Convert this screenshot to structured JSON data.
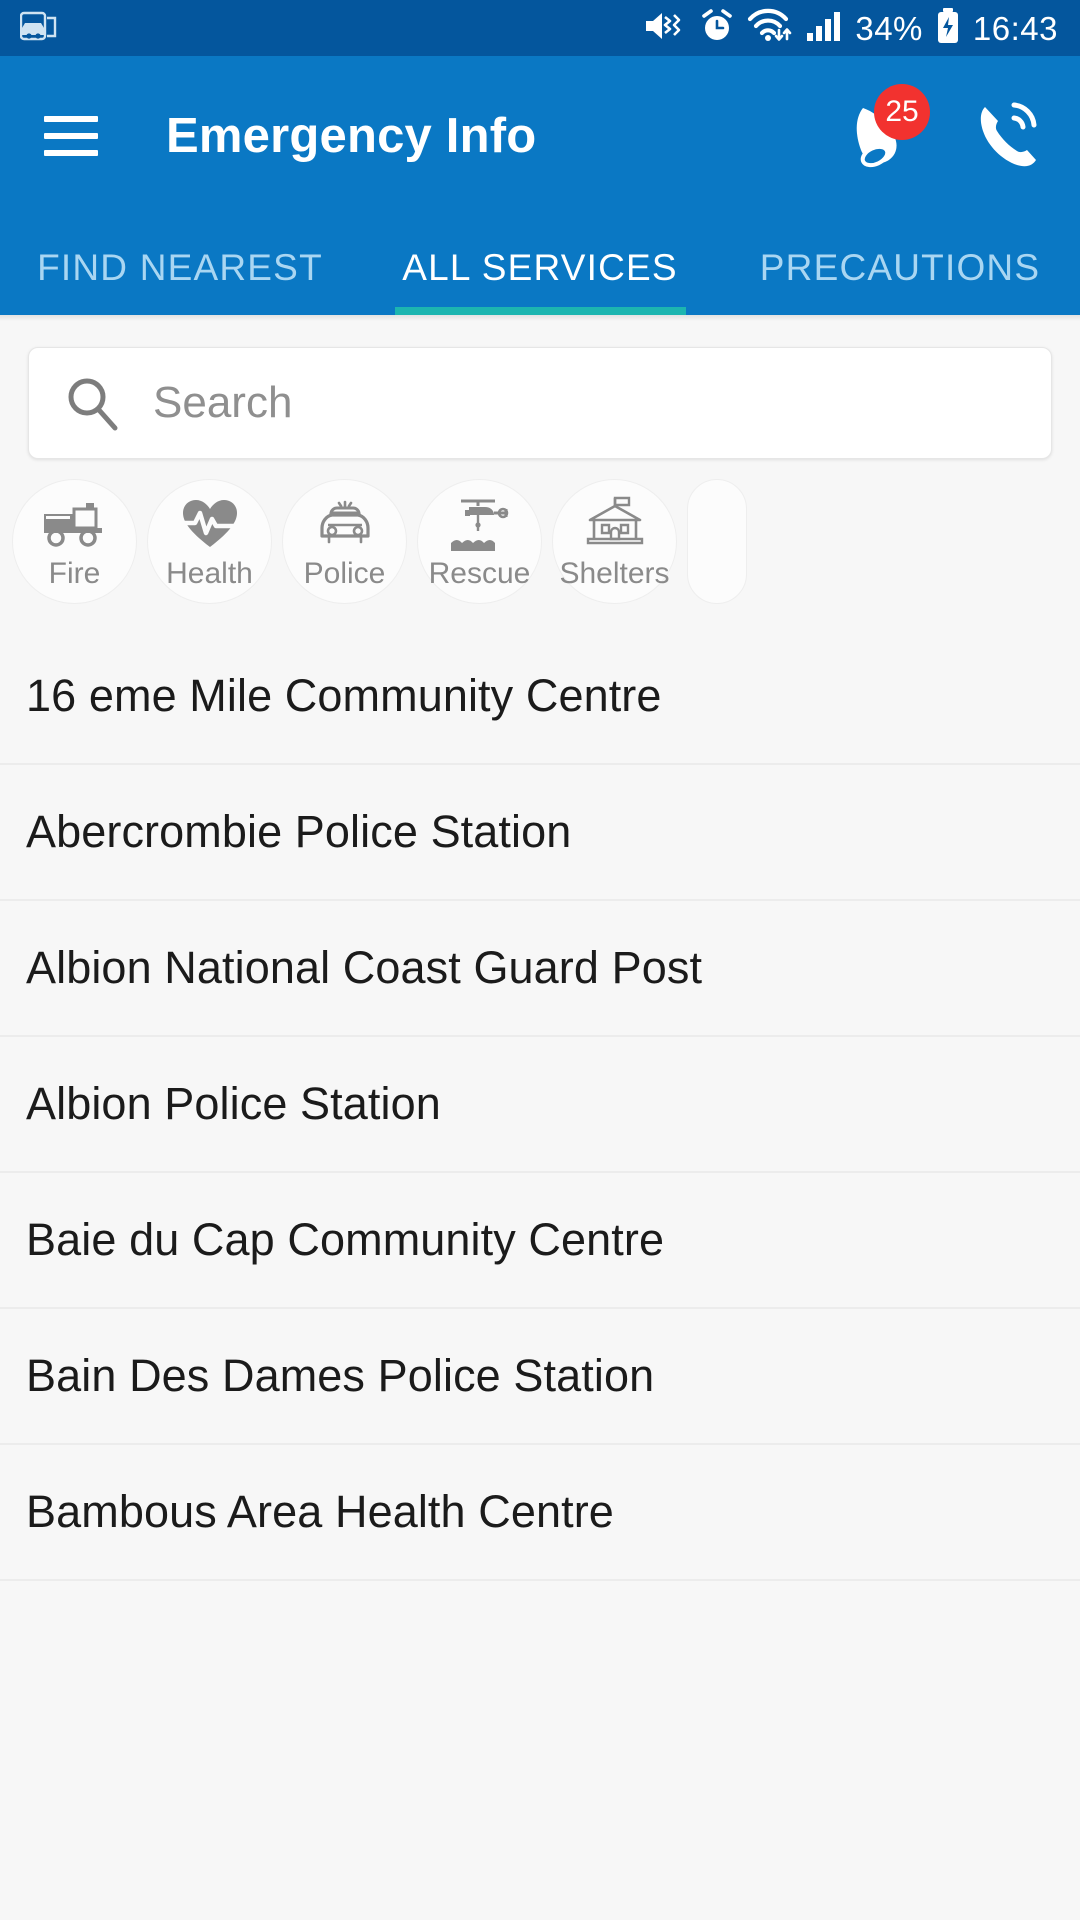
{
  "status_bar": {
    "left_icons": [
      "car-app-icon"
    ],
    "right_icons": [
      "mute-vibrate-icon",
      "alarm-icon",
      "wifi-icon",
      "signal-icon",
      "battery-charging-icon"
    ],
    "battery_percent": "34%",
    "time": "16:43"
  },
  "app_bar": {
    "menu_icon": "hamburger-menu-icon",
    "title": "Emergency Info",
    "notification_icon": "megaphone-icon",
    "notification_badge": "25",
    "call_icon": "phone-ringing-icon"
  },
  "tabs": {
    "items": [
      {
        "label": "FIND NEAREST",
        "active": false
      },
      {
        "label": "ALL SERVICES",
        "active": true
      },
      {
        "label": "PRECAUTIONS",
        "active": false
      }
    ],
    "indicator_color": "#1CB5B0"
  },
  "search": {
    "icon": "search-icon",
    "placeholder": "Search",
    "value": ""
  },
  "categories": [
    {
      "label": "Fire",
      "icon": "fire-truck-icon"
    },
    {
      "label": "Health",
      "icon": "heart-pulse-icon"
    },
    {
      "label": "Police",
      "icon": "police-car-icon"
    },
    {
      "label": "Rescue",
      "icon": "rescue-helicopter-icon"
    },
    {
      "label": "Shelters",
      "icon": "shelter-building-icon"
    }
  ],
  "services": [
    {
      "name": "16 eme Mile Community Centre"
    },
    {
      "name": "Abercrombie Police Station"
    },
    {
      "name": "Albion National Coast Guard Post"
    },
    {
      "name": "Albion Police Station"
    },
    {
      "name": "Baie du Cap Community Centre"
    },
    {
      "name": "Bain Des Dames Police Station"
    },
    {
      "name": "Bambous Area Health Centre"
    }
  ],
  "colors": {
    "status_bar": "#04569D",
    "app_bar": "#0A78C4",
    "accent": "#1CB5B0",
    "badge": "#F2322F",
    "page_bg": "#F7F7F7"
  }
}
